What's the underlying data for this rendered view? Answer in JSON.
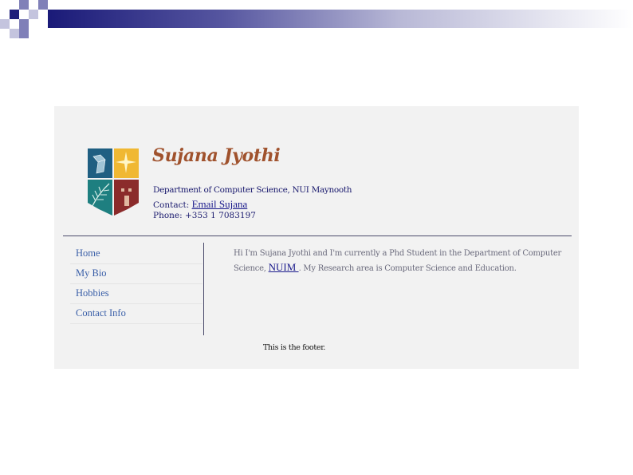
{
  "header": {
    "name": "Sujana Jyothi",
    "department": "Department of Computer Science, NUI Maynooth",
    "contact_label": "Contact:",
    "email_link": "Email Sujana",
    "phone": "Phone: +353 1 7083197"
  },
  "nav": {
    "items": [
      {
        "label": "Home"
      },
      {
        "label": "My Bio"
      },
      {
        "label": "Hobbies"
      },
      {
        "label": "Contact Info"
      }
    ]
  },
  "main": {
    "intro_before_link": "Hi I'm Sujana Jyothi and I'm currently a Phd Student in the Department of Computer Science, ",
    "nuim_link": "NUIM ",
    "intro_after_link": ". My Research area is Computer Science and Education."
  },
  "footer": {
    "text": "This is the footer."
  },
  "colors": {
    "name": "#a0522d",
    "nav_link": "#3a5fa8",
    "link": "#1a1a8c",
    "panel_bg": "#f2f2f2"
  }
}
